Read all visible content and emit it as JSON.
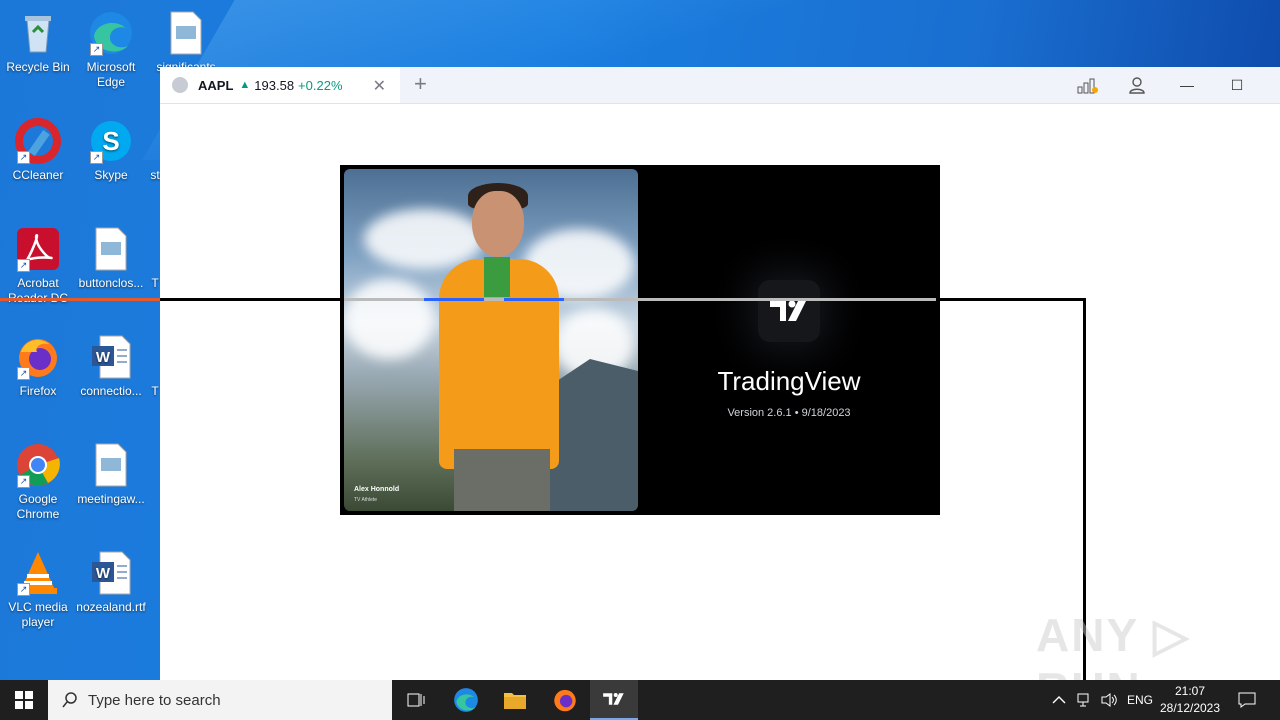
{
  "desktop": {
    "icons": [
      {
        "label": "Recycle Bin"
      },
      {
        "label": "Microsoft Edge"
      },
      {
        "label": "significants"
      },
      {
        "label": "CCleaner"
      },
      {
        "label": "Skype"
      },
      {
        "label": "st"
      },
      {
        "label": "Acrobat Reader DC"
      },
      {
        "label": "buttonclos..."
      },
      {
        "label": "T"
      },
      {
        "label": "Firefox"
      },
      {
        "label": "connectio..."
      },
      {
        "label": "T"
      },
      {
        "label": "Google Chrome"
      },
      {
        "label": "meetingaw..."
      },
      {
        "label": "VLC media player"
      },
      {
        "label": "nozealand.rtf"
      }
    ]
  },
  "window": {
    "tab": {
      "symbol": "AAPL",
      "arrow": "▲",
      "price": "193.58",
      "change": "+0.22%",
      "close": "✕"
    },
    "new_tab": "+",
    "controls": {
      "minimize": "—",
      "maximize": "☐"
    }
  },
  "splash": {
    "caption_name": "Alex Honnold",
    "caption_sub": "TV Athlete",
    "title": "TradingView",
    "version": "Version 2.6.1 • 9/18/2023"
  },
  "watermark": "ANY ▷ RUN",
  "taskbar": {
    "search_placeholder": "Type here to search",
    "lang": "ENG",
    "time": "21:07",
    "date": "28/12/2023"
  }
}
